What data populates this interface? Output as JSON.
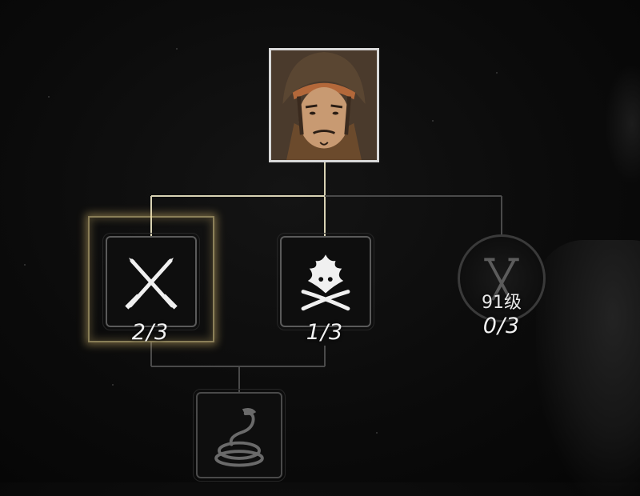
{
  "skill_tree": {
    "character": {
      "name": "",
      "icon": "samurai-portrait"
    },
    "skills": [
      {
        "id": "crossed-swords",
        "icon": "crossed-swords-icon",
        "count": "2/3",
        "state": "selected"
      },
      {
        "id": "flaming-swords",
        "icon": "flame-crossed-swords-icon",
        "count": "1/3",
        "state": "unlocked"
      },
      {
        "id": "locked-swords",
        "icon": "crossed-swords-faded-icon",
        "level_req": "91级",
        "count": "0/3",
        "state": "locked"
      },
      {
        "id": "serpent",
        "icon": "serpent-icon",
        "state": "locked"
      }
    ],
    "colors": {
      "glow": "#e6c878",
      "line": "#d8d2b4",
      "line_dim": "#4a4a4a",
      "frame": "#5a5a5a"
    }
  }
}
